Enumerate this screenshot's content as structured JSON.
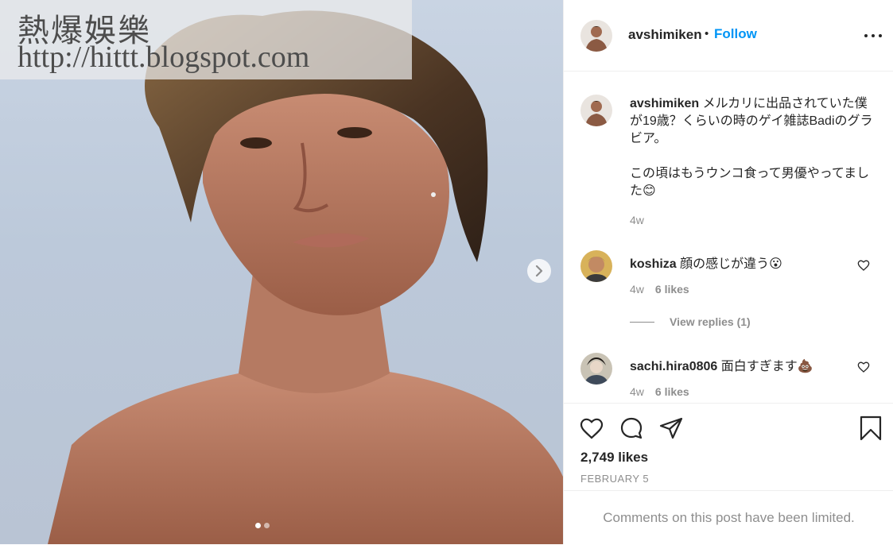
{
  "watermark": {
    "line1": "熱爆娛樂",
    "line2": "http://hittt.blogspot.com"
  },
  "carousel": {
    "slide_count": 2,
    "active_index": 0,
    "next_icon": "chevron-right-icon"
  },
  "header": {
    "username": "avshimiken",
    "bullet": "•",
    "follow_label": "Follow",
    "more_icon": "more-horizontal-icon"
  },
  "caption": {
    "username": "avshimiken",
    "text": "メルカリに出品されていた僕が19歳？くらいの時のゲイ雑誌Badiのグラビア。\n\nこの頃はもうウンコ食って男優やってました😊",
    "time": "4w"
  },
  "comments": [
    {
      "username": "koshiza",
      "text": "顔の感じが違う😮",
      "time": "4w",
      "likes": "6 likes"
    },
    {
      "username": "sachi.hira0806",
      "text": "面白すぎます💩",
      "time": "4w",
      "likes": "6 likes"
    }
  ],
  "view_replies": "View replies (1)",
  "actions": {
    "like_icon": "heart-icon",
    "comment_icon": "comment-icon",
    "share_icon": "share-icon",
    "save_icon": "bookmark-icon"
  },
  "likes_count": "2,749 likes",
  "post_date": "FEBRUARY 5",
  "comments_limited": "Comments on this post have been limited.",
  "colors": {
    "accent": "#0095f6",
    "muted": "#8e8e8e",
    "text": "#262626",
    "border": "#efefef"
  }
}
